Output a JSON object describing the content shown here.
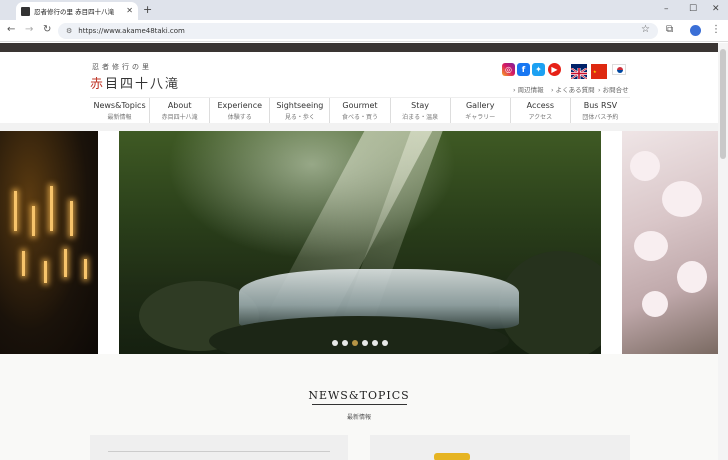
{
  "browser": {
    "tab_title": "忍者修行の里 赤目四十八滝",
    "url": "https://www.akame48taki.com"
  },
  "site": {
    "logo_sub": "忍者修行の里",
    "logo_main_red": "赤",
    "logo_main_rest": "目四十八滝",
    "quick_links": [
      "› 周辺情報",
      "› よくある質問",
      "› お問合せ"
    ],
    "menu": [
      {
        "en": "News&Topics",
        "jp": "最新情報"
      },
      {
        "en": "About",
        "jp": "赤目四十八滝"
      },
      {
        "en": "Experience",
        "jp": "体験する"
      },
      {
        "en": "Sightseeing",
        "jp": "見る・歩く"
      },
      {
        "en": "Gourmet",
        "jp": "食べる・買う"
      },
      {
        "en": "Stay",
        "jp": "泊まる・温泉"
      },
      {
        "en": "Gallery",
        "jp": "ギャラリー"
      },
      {
        "en": "Access",
        "jp": "アクセス"
      },
      {
        "en": "Bus RSV",
        "jp": "団体バス予約"
      }
    ],
    "social": {
      "facebook": "f"
    },
    "slider": {
      "dot_count": 6,
      "active_index": 2
    }
  },
  "news": {
    "title": "NEWS&TOPICS",
    "subtitle": "最新情報"
  },
  "colors": {
    "accent_red": "#c0392b",
    "badge_gold": "#e6b422",
    "top_strip": "#3a3533"
  }
}
